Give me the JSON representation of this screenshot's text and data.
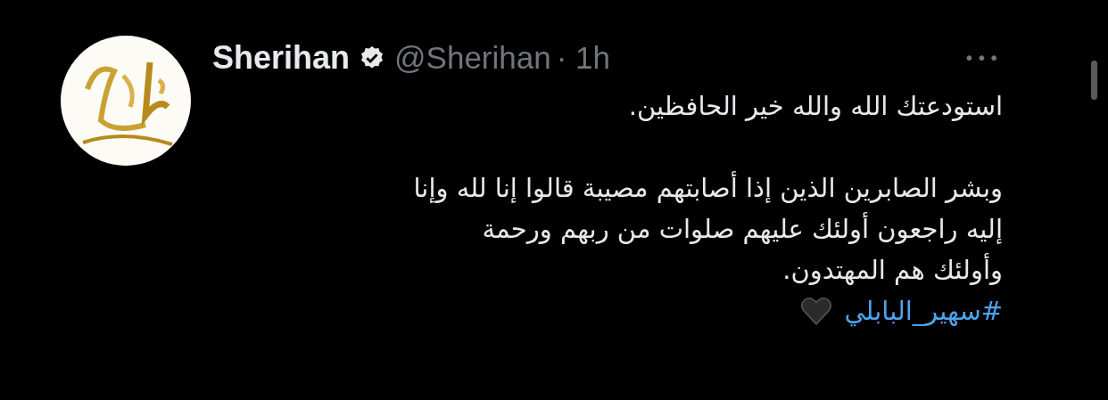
{
  "tweet": {
    "author": {
      "name": "Sherihan",
      "verified": true,
      "handle": "@Sherihan",
      "time": "· 1h"
    },
    "more": "•••",
    "paragraphs": [
      "استودعتك الله والله خير الحافظين.",
      "وبشر الصابرين الذين إذا أصابتهم مصيبة قالوا إنا لله وإنا\nإليه راجعون أولئك عليهم صلوات من ربهم ورحمة\nوأولئك هم المهتدون."
    ],
    "hashtag": "#سهير_البابلي"
  }
}
